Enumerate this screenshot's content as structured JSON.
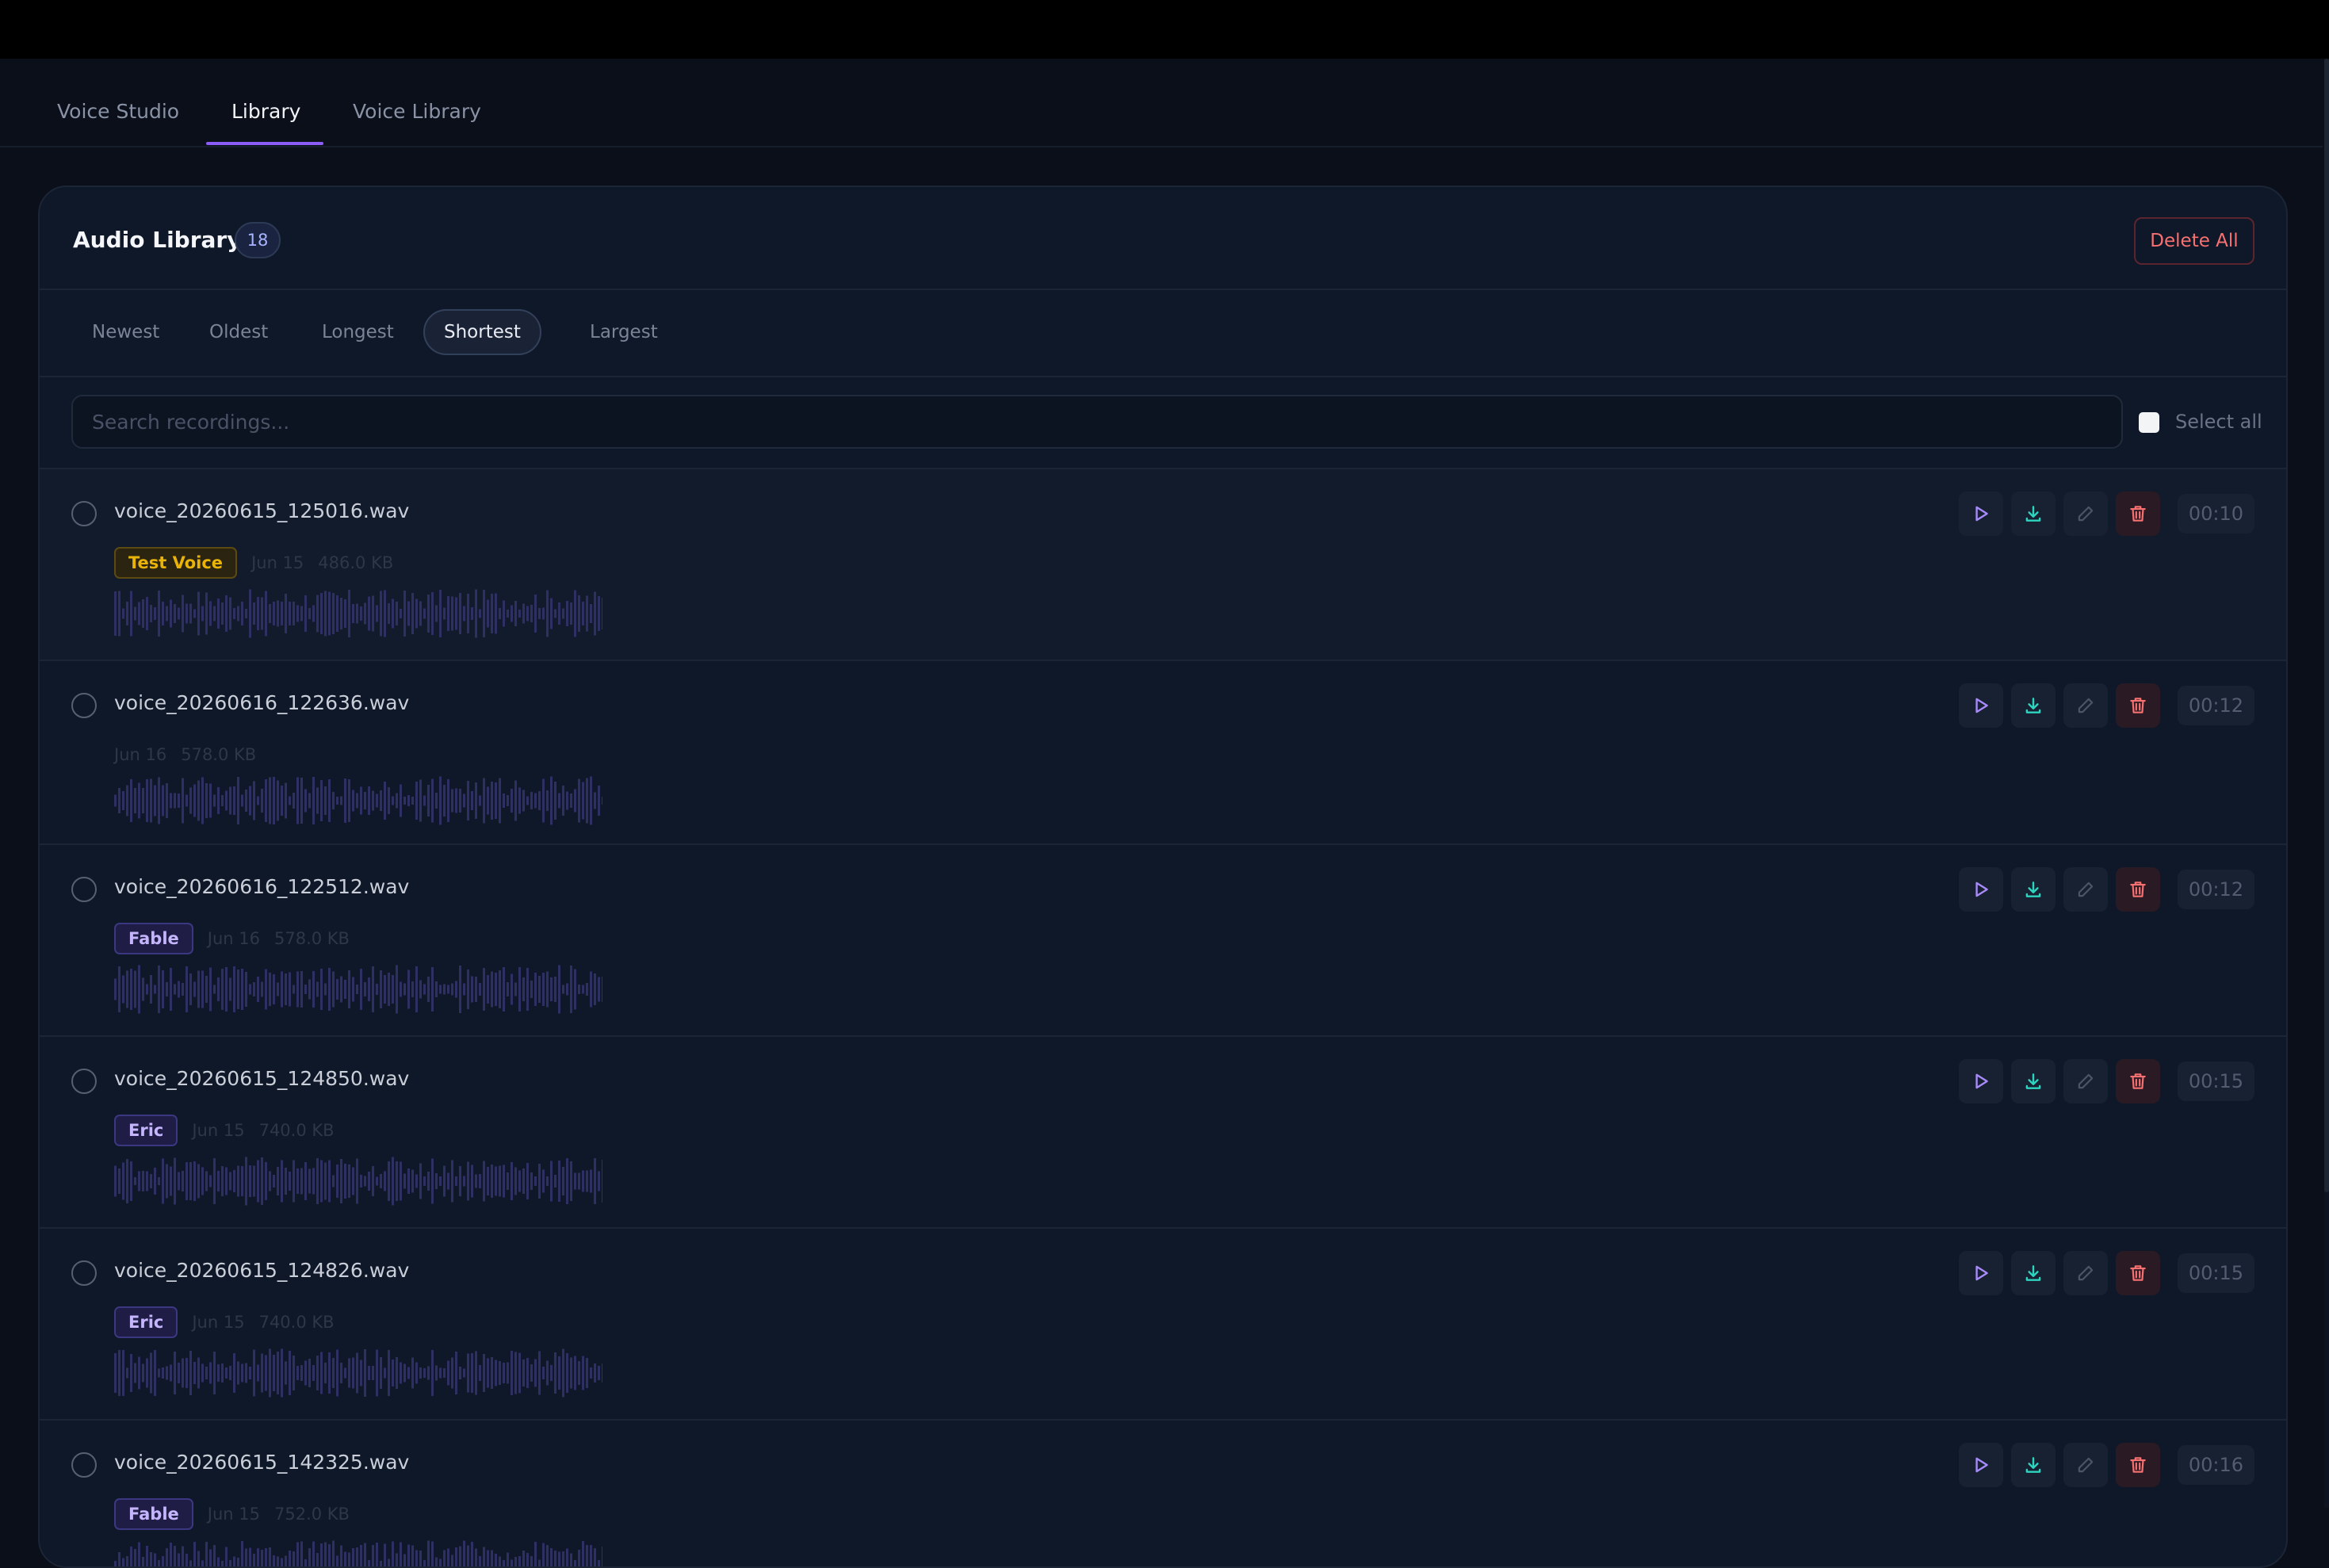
{
  "tabs": [
    {
      "label": "Voice Studio",
      "active": false
    },
    {
      "label": "Library",
      "active": true
    },
    {
      "label": "Voice Library",
      "active": false
    }
  ],
  "library": {
    "title": "Audio Library",
    "count": "18",
    "delete_all_label": "Delete All"
  },
  "sort_options": [
    {
      "label": "Newest",
      "active": false
    },
    {
      "label": "Oldest",
      "active": false
    },
    {
      "label": "Longest",
      "active": false
    },
    {
      "label": "Shortest",
      "active": true
    },
    {
      "label": "Largest",
      "active": false
    }
  ],
  "search": {
    "placeholder": "Search recordings...",
    "value": ""
  },
  "select_all_label": "Select all",
  "colors": {
    "accent": "#8b5cf6",
    "danger": "#f87171",
    "download": "#2dd4bf",
    "tag_test_voice_text": "#eab308",
    "tag_voice_text": "#c4b5fd"
  },
  "icons": [
    "play-icon",
    "download-icon",
    "edit-icon",
    "trash-icon"
  ],
  "recordings": [
    {
      "name": "voice_20260615_125016.wav",
      "tag": "Test Voice",
      "tag_style": "gold",
      "date": "Jun 15",
      "size": "486.0 KB",
      "duration": "00:10"
    },
    {
      "name": "voice_20260616_122636.wav",
      "tag": "",
      "tag_style": "",
      "date": "Jun 16",
      "size": "578.0 KB",
      "duration": "00:12"
    },
    {
      "name": "voice_20260616_122512.wav",
      "tag": "Fable",
      "tag_style": "purple",
      "date": "Jun 16",
      "size": "578.0 KB",
      "duration": "00:12"
    },
    {
      "name": "voice_20260615_124850.wav",
      "tag": "Eric",
      "tag_style": "purple",
      "date": "Jun 15",
      "size": "740.0 KB",
      "duration": "00:15"
    },
    {
      "name": "voice_20260615_124826.wav",
      "tag": "Eric",
      "tag_style": "purple",
      "date": "Jun 15",
      "size": "740.0 KB",
      "duration": "00:15"
    },
    {
      "name": "voice_20260615_142325.wav",
      "tag": "Fable",
      "tag_style": "purple",
      "date": "Jun 15",
      "size": "752.0 KB",
      "duration": "00:16"
    }
  ]
}
